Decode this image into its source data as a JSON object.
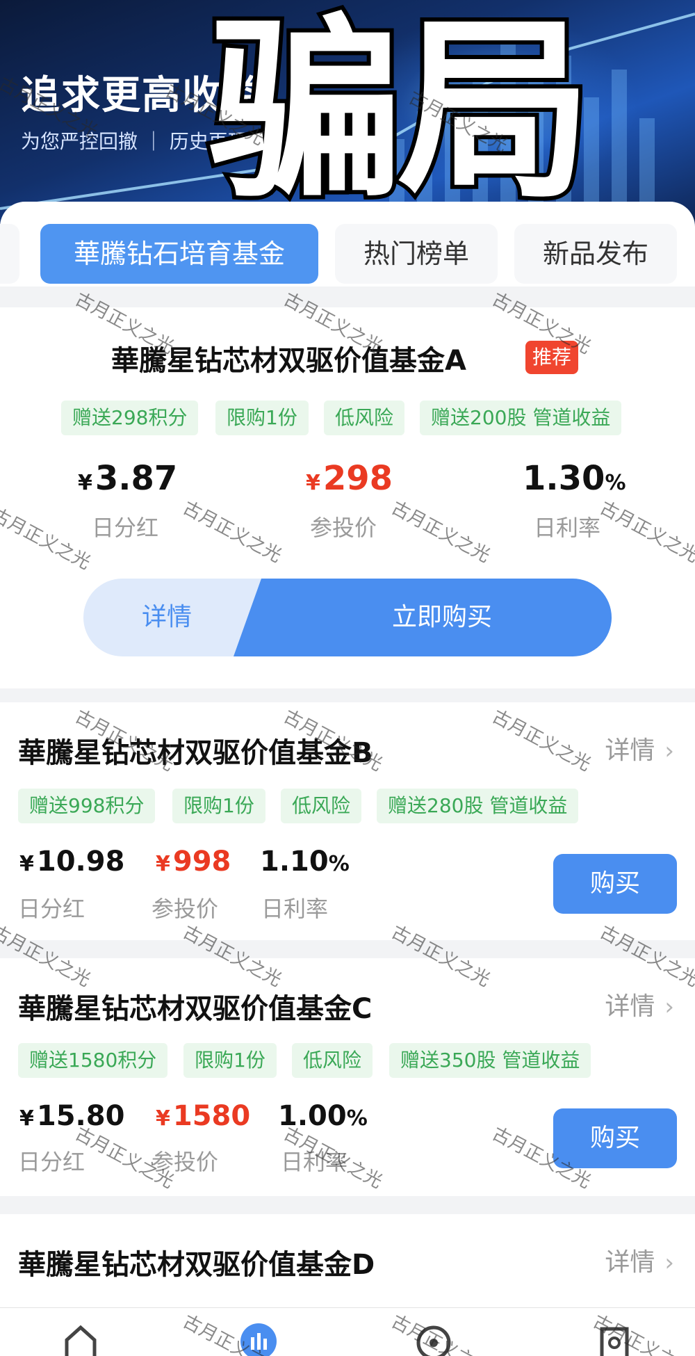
{
  "hero": {
    "title": "追求更高收益",
    "subtitle": "为您严控回撤 ｜ 历史再现",
    "overlay_text": "骗局"
  },
  "tabs": [
    {
      "label": "華騰钻石培育基金",
      "active": true
    },
    {
      "label": "热门榜单",
      "active": false
    },
    {
      "label": "新品发布",
      "active": false
    }
  ],
  "featured": {
    "title": "華騰星钻芯材双驱价值基金A",
    "badge": "推荐",
    "tags": [
      "赠送298积分",
      "限购1份",
      "低风险",
      "赠送200股 管道收益"
    ],
    "stats": [
      {
        "currency": "¥",
        "value": "3.87",
        "suffix": "",
        "label": "日分红"
      },
      {
        "currency": "¥",
        "value": "298",
        "suffix": "",
        "label": "参投价"
      },
      {
        "currency": "",
        "value": "1.30",
        "suffix": "%",
        "label": "日利率"
      }
    ],
    "detail_label": "详情",
    "buy_label": "立即购买"
  },
  "products": [
    {
      "title": "華騰星钻芯材双驱价值基金B",
      "detail_label": "详情",
      "tags": [
        "赠送998积分",
        "限购1份",
        "低风险",
        "赠送280股 管道收益"
      ],
      "stats": [
        {
          "currency": "¥",
          "value": "10.98",
          "suffix": "",
          "label": "日分红"
        },
        {
          "currency": "¥",
          "value": "998",
          "suffix": "",
          "label": "参投价"
        },
        {
          "currency": "",
          "value": "1.10",
          "suffix": "%",
          "label": "日利率"
        }
      ],
      "buy_label": "购买"
    },
    {
      "title": "華騰星钻芯材双驱价值基金C",
      "detail_label": "详情",
      "tags": [
        "赠送1580积分",
        "限购1份",
        "低风险",
        "赠送350股 管道收益"
      ],
      "stats": [
        {
          "currency": "¥",
          "value": "15.80",
          "suffix": "",
          "label": "日分红"
        },
        {
          "currency": "¥",
          "value": "1580",
          "suffix": "",
          "label": "参投价"
        },
        {
          "currency": "",
          "value": "1.00",
          "suffix": "%",
          "label": "日利率"
        }
      ],
      "buy_label": "购买"
    },
    {
      "title": "華騰星钻芯材双驱价值基金D",
      "detail_label": "详情"
    }
  ],
  "watermark": "古月正义之光",
  "nav_icons": [
    "home-icon",
    "chart-icon",
    "compass-icon",
    "profile-icon"
  ],
  "colors": {
    "accent": "#4a8ef0",
    "price_red": "#ea3a22",
    "tag_green": "#3aa856",
    "badge_red": "#f0452f"
  }
}
